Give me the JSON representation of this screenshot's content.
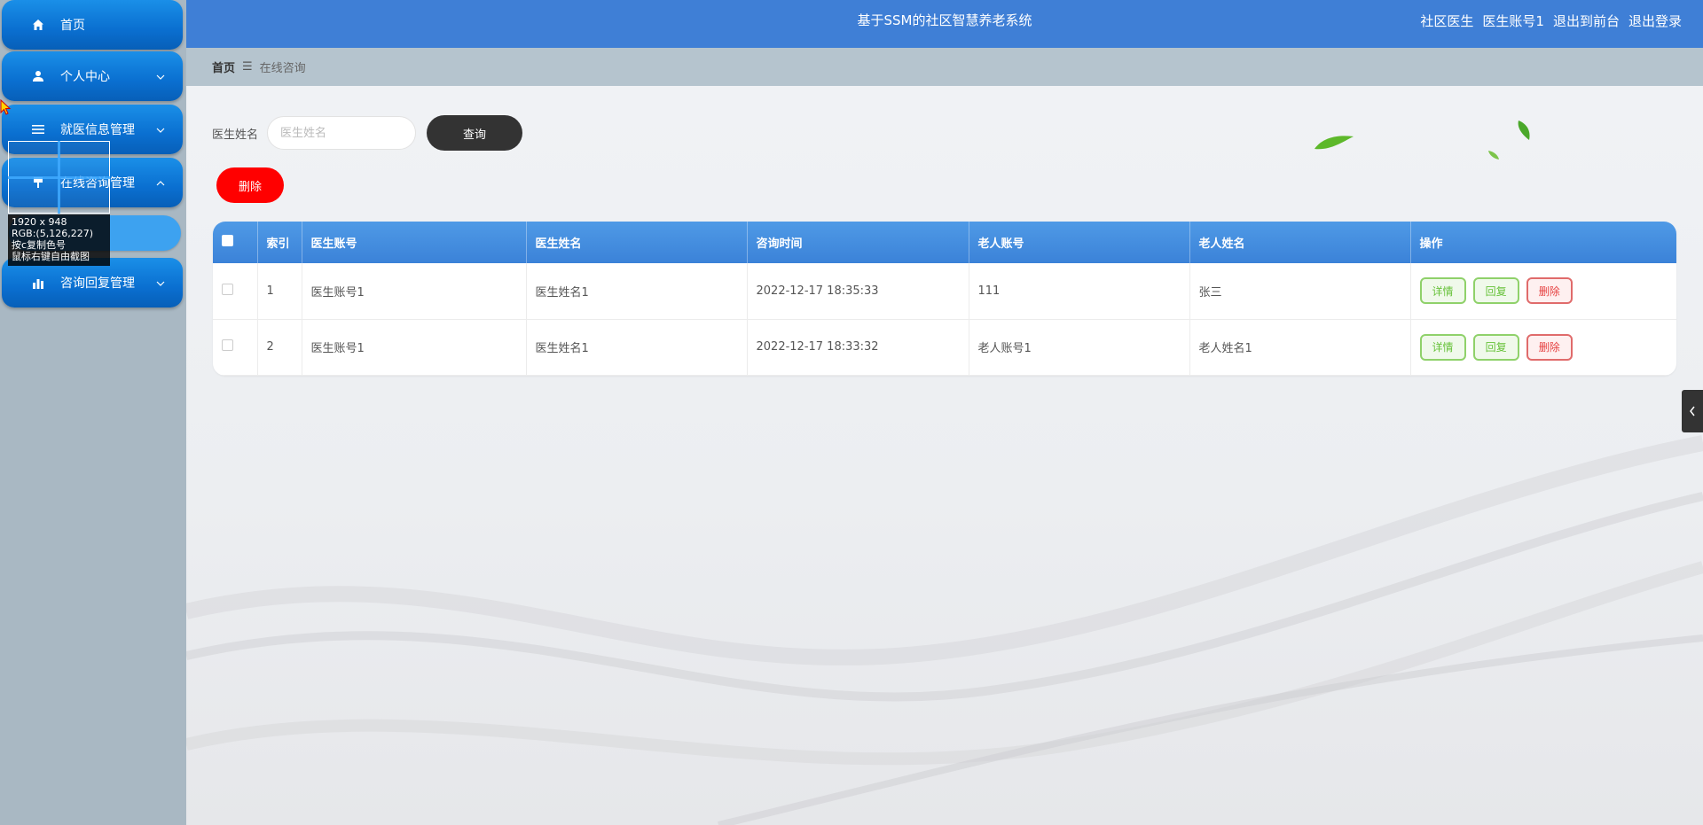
{
  "colors": {
    "topbar": "#3f7fd6",
    "menu": "#0a6fd0",
    "danger": "#ff0000",
    "dark": "#333333",
    "header": "#3b82d8"
  },
  "sidebar": {
    "items": [
      {
        "label": "首页",
        "icon": "home-icon"
      },
      {
        "label": "个人中心",
        "icon": "user-icon"
      },
      {
        "label": "就医信息管理",
        "icon": "list-icon"
      },
      {
        "label": "在线咨询管理",
        "icon": "pin-icon"
      },
      {
        "label": "咨询回复管理",
        "icon": "bar-chart-icon"
      }
    ]
  },
  "overlay": {
    "size": "1920 x 948",
    "rgb": "RGB:(5,126,227)",
    "hint1": "按c复制色号",
    "hint2": "鼠标右键自由截图"
  },
  "header": {
    "title": "基于SSM的社区智慧养老系统",
    "role": "社区医生",
    "account": "医生账号1",
    "front_link": "退出到前台",
    "logout_link": "退出登录"
  },
  "breadcrumb": {
    "home": "首页",
    "sep": "☰",
    "current": "在线咨询"
  },
  "search": {
    "label": "医生姓名",
    "placeholder": "医生姓名",
    "value": "",
    "button": "查询"
  },
  "delete_button": "删除",
  "table": {
    "headers": [
      "索引",
      "医生账号",
      "医生姓名",
      "咨询时间",
      "老人账号",
      "老人姓名",
      "操作"
    ],
    "rows": [
      {
        "index": "1",
        "doctor_account": "医生账号1",
        "doctor_name": "医生姓名1",
        "time": "2022-12-17 18:35:33",
        "elder_account": "111",
        "elder_name": "张三"
      },
      {
        "index": "2",
        "doctor_account": "医生账号1",
        "doctor_name": "医生姓名1",
        "time": "2022-12-17 18:33:32",
        "elder_account": "老人账号1",
        "elder_name": "老人姓名1"
      }
    ],
    "actions": {
      "detail": "详情",
      "reply": "回复",
      "delete": "删除"
    }
  }
}
